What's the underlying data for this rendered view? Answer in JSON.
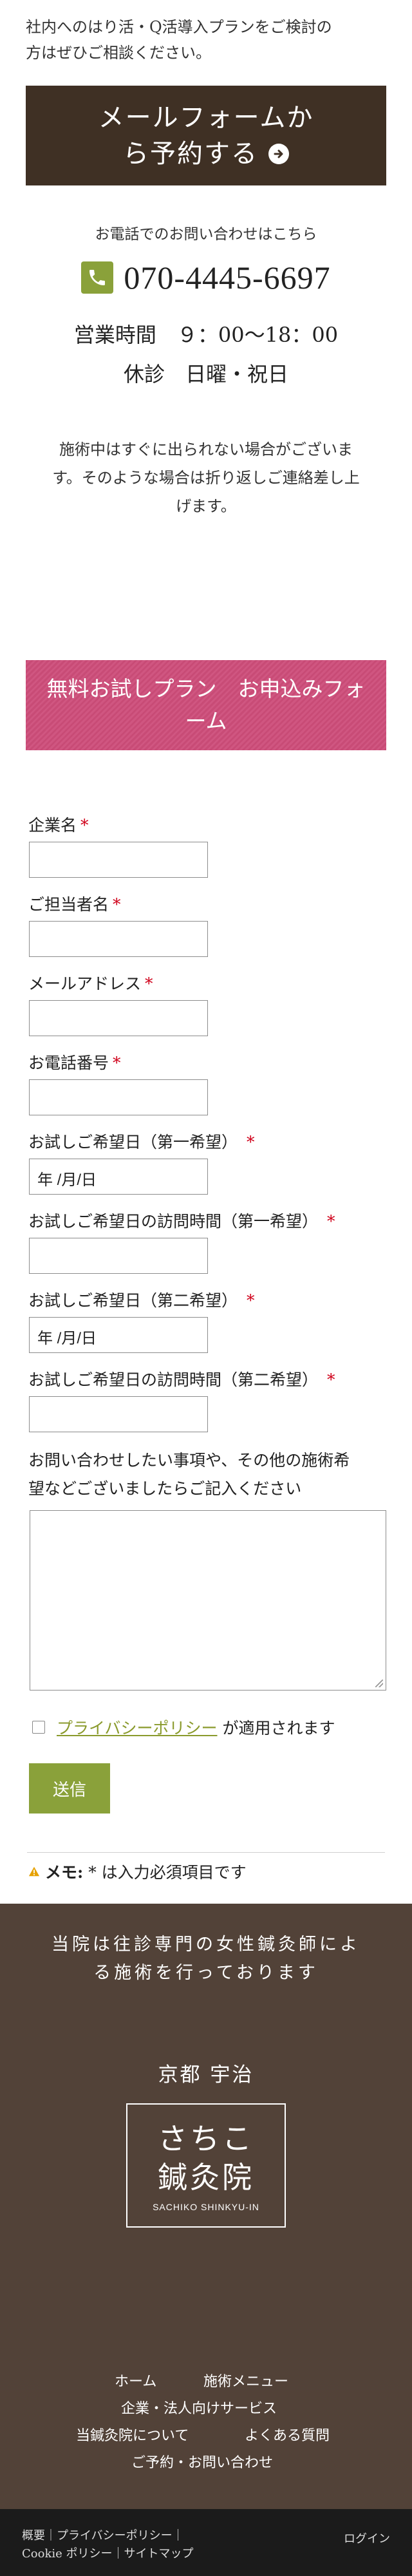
{
  "intro": {
    "line1": "社内へのはり活・Q活導入プランをご検討の",
    "line2": "方はぜひご相談ください。"
  },
  "mail_button": {
    "line1": "メールフォームか",
    "line2": "ら予約する"
  },
  "contact": {
    "caption": "お電話でのお問い合わせはこちら",
    "phone": "070-4445-6697",
    "hours": "営業時間　９：00〜18：00",
    "holiday": "休診　日曜・祝日"
  },
  "notice": {
    "line1": "施術中はすぐに出られない場合がございま",
    "line2": "す。そのような場合は折り返しご連絡差し上",
    "line3": "げます。"
  },
  "banner": {
    "line1": "無料お試しプラン　お申込みフォ",
    "line2": "ーム"
  },
  "form": {
    "required_mark": "*",
    "company": "企業名",
    "person": "ご担当者名",
    "email": "メールアドレス",
    "phone": "お電話番号",
    "date1": "お試しご希望日（第一希望）",
    "time1": "お試しご希望日の訪問時間（第一希望）",
    "date2": "お試しご希望日（第二希望）",
    "time2": "お試しご希望日の訪問時間（第二希望）",
    "date_placeholder": "年 /月/日",
    "inquiry_line1": "お問い合わせしたい事項や、その他の施術希",
    "inquiry_line2": "望などございましたらご記入ください",
    "privacy_link": "プライバシーポリシー",
    "privacy_suffix": "が適用されます",
    "submit": "送信",
    "memo_label": "メモ:",
    "memo_text": "* は入力必須項目です"
  },
  "footer": {
    "tagline_line1": "当院は往診専門の女性鍼灸師によ",
    "tagline_line2": "る施術を行っております",
    "place": "京都 宇治",
    "logo_line1": "さちこ",
    "logo_line2": "鍼灸院",
    "logo_sub": "SACHIKO SHINKYU-IN",
    "nav": {
      "home": "ホーム",
      "menu": "施術メニュー",
      "corporate": "企業・法人向けサービス",
      "about": "当鍼灸院について",
      "faq": "よくある質問",
      "reserve": "ご予約・お問い合わせ"
    },
    "bottom_line1": "概要｜プライバシーポリシー｜",
    "bottom_line2": "Cookie ポリシー｜サイトマップ",
    "login": "ログイン"
  },
  "colors": {
    "dark_brown": "#3f3024",
    "footer_brown": "#524238",
    "green": "#8aa13a",
    "pink": "#c84b76"
  }
}
